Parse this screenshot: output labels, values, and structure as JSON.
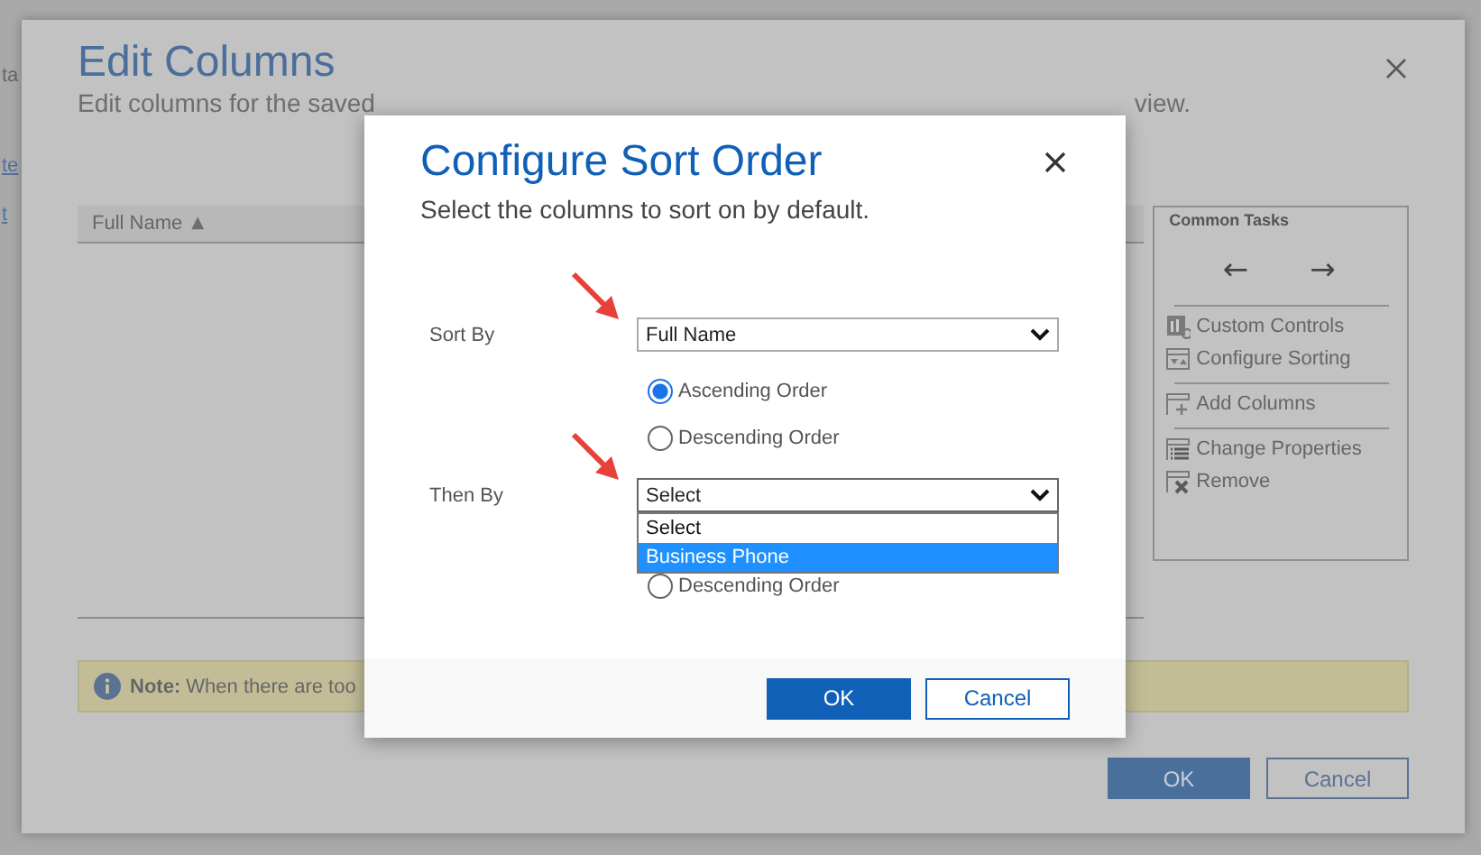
{
  "background_page": {
    "fragments": [
      {
        "text": "ta",
        "kind": "text"
      },
      {
        "text": "te",
        "kind": "link"
      },
      {
        "text": "t",
        "kind": "link"
      }
    ]
  },
  "edit_columns": {
    "title": "Edit Columns",
    "subtitle_parts": [
      "Edit columns for the saved",
      "view."
    ],
    "grid_columns": [
      {
        "label": "Full Name",
        "sort_indicator": "▲"
      }
    ],
    "common_tasks": {
      "title": "Common Tasks",
      "move_left": "←",
      "move_right": "→",
      "groups": [
        {
          "items": [
            {
              "label": "Custom Controls",
              "kind": "controls"
            },
            {
              "label": "Configure Sorting",
              "kind": "sorting"
            }
          ]
        },
        {
          "items": [
            {
              "label": "Add Columns",
              "kind": "add"
            }
          ]
        },
        {
          "items": [
            {
              "label": "Change Properties",
              "kind": "properties"
            },
            {
              "label": "Remove",
              "kind": "remove"
            }
          ]
        }
      ]
    },
    "note": "**Note:** When there are too",
    "buttons": [
      {
        "label": "OK",
        "kind": "primary"
      },
      {
        "label": "Cancel",
        "kind": "secondary"
      }
    ]
  },
  "sort_dialog": {
    "title": "Configure Sort Order",
    "subtitle": "Select the columns to sort on by default.",
    "sort_by": {
      "label": "Sort By",
      "value": "Full Name",
      "orders": [
        {
          "label": "Ascending Order",
          "selected": true
        },
        {
          "label": "Descending Order",
          "selected": false
        }
      ]
    },
    "then_by": {
      "label": "Then By",
      "value": "Select",
      "expanded": true,
      "options": [
        {
          "label": "Select",
          "highlighted": false
        },
        {
          "label": "Business Phone",
          "highlighted": true
        }
      ],
      "orders": [
        {
          "label": "Descending Order",
          "selected": false
        }
      ]
    },
    "buttons": [
      {
        "label": "OK",
        "kind": "primary"
      },
      {
        "label": "Cancel",
        "kind": "secondary"
      }
    ]
  }
}
